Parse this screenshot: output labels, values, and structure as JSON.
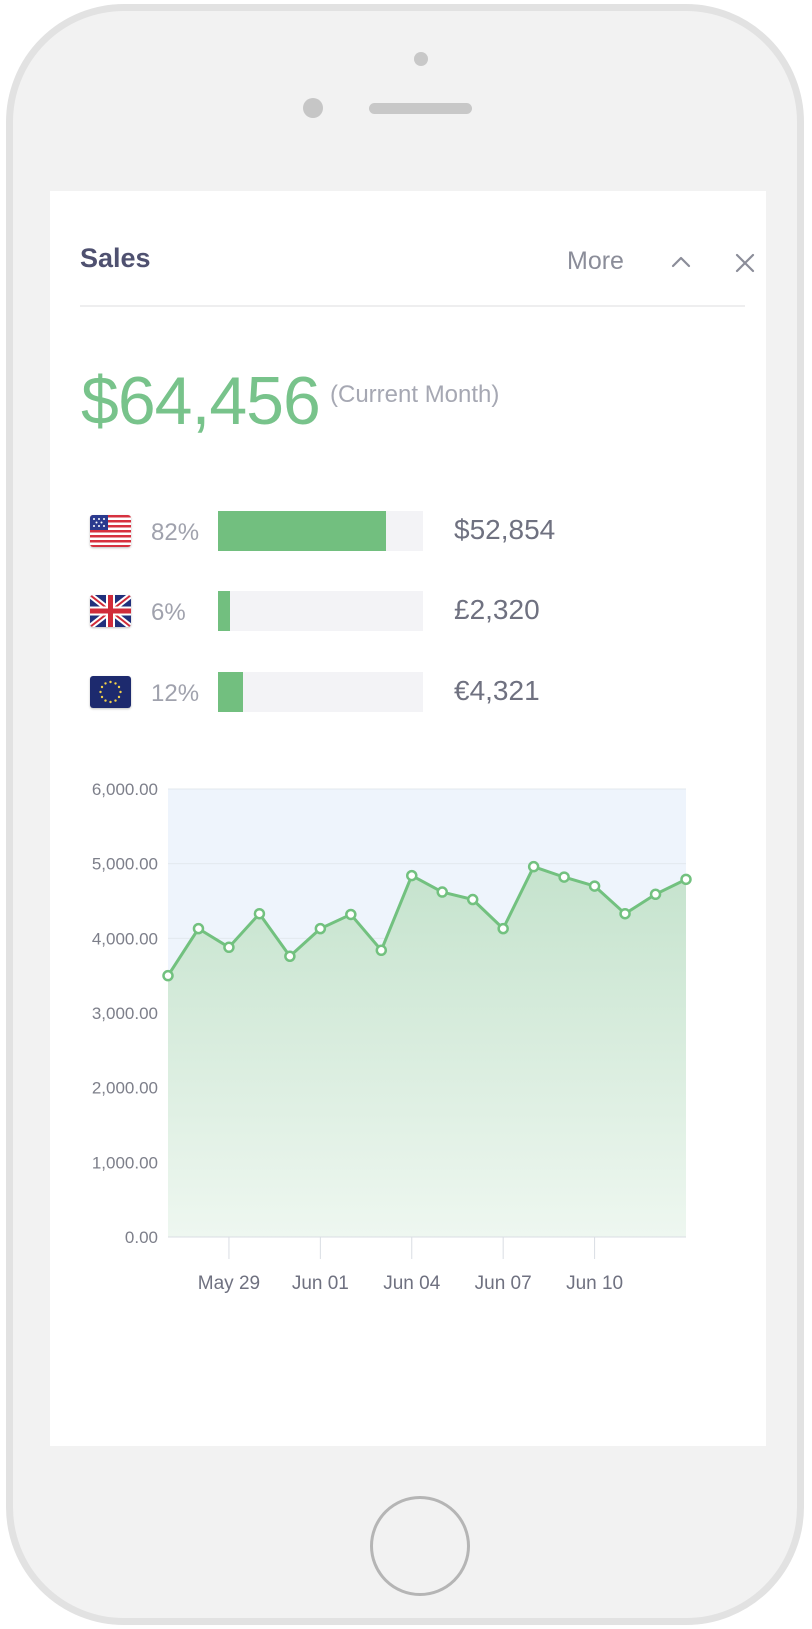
{
  "widget": {
    "title": "Sales",
    "more_label": "More",
    "collapse_icon": "chevron-up-icon",
    "close_icon": "close-icon"
  },
  "summary": {
    "total": "$64,456",
    "period_note": "(Current Month)"
  },
  "regions": [
    {
      "flag_icon": "us-flag-icon",
      "percent_label": "82%",
      "share": 0.82,
      "amount": "$52,854"
    },
    {
      "flag_icon": "uk-flag-icon",
      "percent_label": "6%",
      "share": 0.06,
      "amount": "£2,320"
    },
    {
      "flag_icon": "eu-flag-icon",
      "percent_label": "12%",
      "share": 0.12,
      "amount": "€4,321"
    }
  ],
  "colors": {
    "accent_green": "#78c38b",
    "bar_green": "#72bf7f",
    "bar_track": "#f3f3f6",
    "line_green": "#72c17f",
    "plot_background": "#eef4fc"
  },
  "chart_data": {
    "type": "area",
    "x": [
      "May 27",
      "May 28",
      "May 29",
      "May 30",
      "May 31",
      "Jun 01",
      "Jun 02",
      "Jun 03",
      "Jun 04",
      "Jun 05",
      "Jun 06",
      "Jun 07",
      "Jun 08",
      "Jun 09",
      "Jun 10",
      "Jun 11",
      "Jun 12",
      "Jun 13"
    ],
    "series": [
      {
        "values": [
          3500,
          4130,
          3880,
          4330,
          3760,
          4130,
          4320,
          3840,
          4840,
          4620,
          4520,
          4130,
          4960,
          4820,
          4700,
          4330,
          4590,
          4790
        ]
      }
    ],
    "x_tick_labels": [
      "May 29",
      "Jun 01",
      "Jun 04",
      "Jun 07",
      "Jun 10"
    ],
    "y_tick_labels": [
      "6,000.00",
      "5,000.00",
      "4,000.00",
      "3,000.00",
      "2,000.00",
      "1,000.00",
      "0.00"
    ],
    "y_ticks": [
      6000,
      5000,
      4000,
      3000,
      2000,
      1000,
      0
    ],
    "ylim": [
      0,
      6000
    ],
    "grid": true,
    "legend": "none",
    "title": "",
    "xlabel": "",
    "ylabel": ""
  }
}
